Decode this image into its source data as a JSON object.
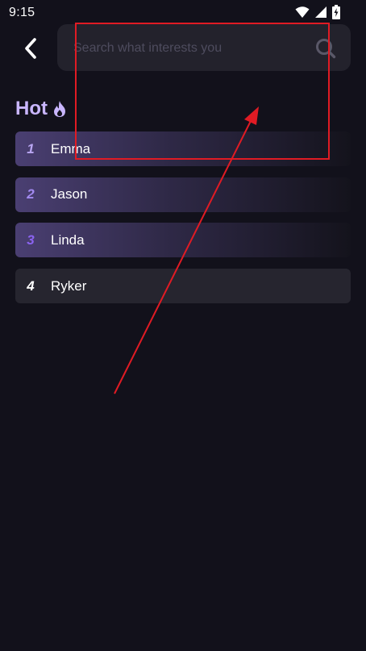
{
  "status_bar": {
    "time": "9:15",
    "icons": [
      "wifi-icon",
      "signal-icon",
      "battery-charging-icon"
    ]
  },
  "header": {
    "back_icon": "chevron-left-icon",
    "search": {
      "placeholder": "Search what interests you",
      "value": "",
      "icon": "search-icon"
    }
  },
  "hot": {
    "title": "Hot",
    "title_icon": "flame-icon",
    "items": [
      {
        "rank": "1",
        "name": "Emma"
      },
      {
        "rank": "2",
        "name": "Jason"
      },
      {
        "rank": "3",
        "name": "Linda"
      },
      {
        "rank": "4",
        "name": "Ryker"
      }
    ]
  },
  "colors": {
    "background": "#12111b",
    "search_bg": "#23222c",
    "accent": "#c9b6ff",
    "annotation": "#e01b24"
  }
}
